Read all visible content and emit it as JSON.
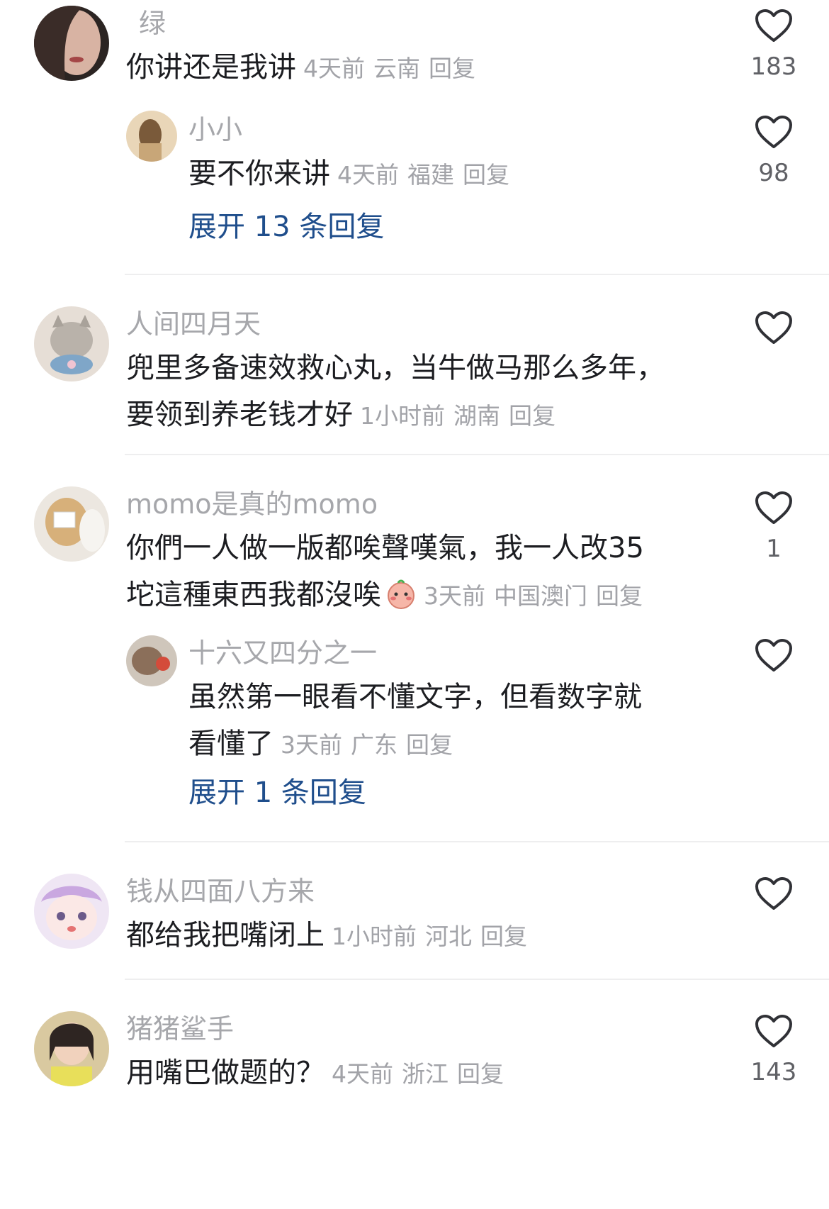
{
  "comments": [
    {
      "name": "绿",
      "text": "你讲还是我讲",
      "time": "4天前",
      "location": "云南",
      "reply": "回复",
      "likes": "183",
      "replies": [
        {
          "name": "小小",
          "text": "要不你来讲",
          "time": "4天前",
          "location": "福建",
          "reply": "回复",
          "likes": "98"
        }
      ],
      "expand": "展开 13 条回复"
    },
    {
      "name": "人间四月天",
      "text": "兜里多备速效救心丸，当牛做马那么多年，要领到养老钱才好",
      "time": "1小时前",
      "location": "湖南",
      "reply": "回复",
      "likes": ""
    },
    {
      "name": "momo是真的momo",
      "text": "你們一人做一版都唉聲嘆氣，我一人改35坨這種東西我都沒唉",
      "time": "3天前",
      "location": "中国澳门",
      "reply": "回复",
      "likes": "1",
      "replies": [
        {
          "name": "十六又四分之一",
          "text": "虽然第一眼看不懂文字，但看数字就看懂了",
          "time": "3天前",
          "location": "广东",
          "reply": "回复",
          "likes": ""
        }
      ],
      "expand": "展开 1 条回复"
    },
    {
      "name": "钱从四面八方来",
      "text": "都给我把嘴闭上",
      "time": "1小时前",
      "location": "河北",
      "reply": "回复",
      "likes": ""
    },
    {
      "name": "猪猪鲨手",
      "text": "用嘴巴做题的？",
      "time": "4天前",
      "location": "浙江",
      "reply": "回复",
      "likes": "143"
    }
  ],
  "icons": {
    "like": "heart-outline-icon",
    "emoji": "blushing-face-emoji"
  },
  "colors": {
    "expand_link": "#1f4e8c",
    "meta_text": "#a2a3a8",
    "name_text": "#a6a7ab"
  }
}
